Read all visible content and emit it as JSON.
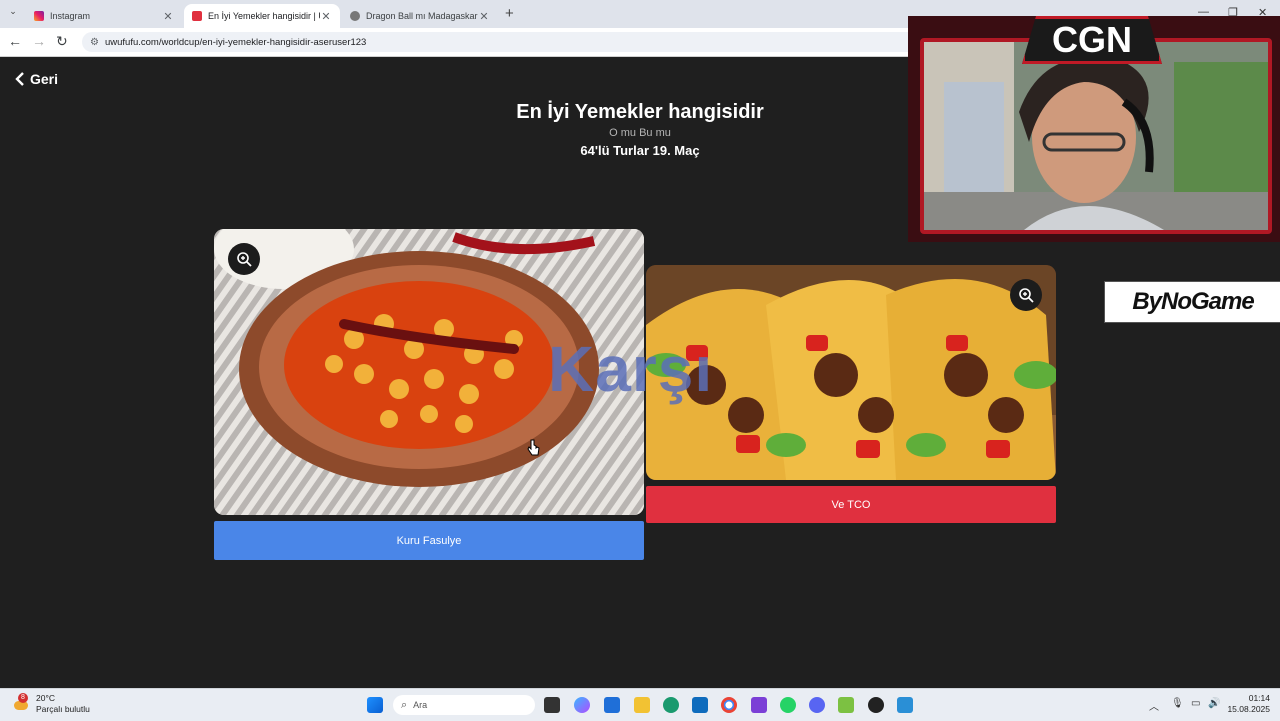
{
  "browser": {
    "tabs": [
      {
        "title": "Instagram",
        "active": false
      },
      {
        "title": "En İyi Yemekler hangisidir | Uwu",
        "active": true
      },
      {
        "title": "Dragon Ball mı Madagaskar mı",
        "active": false
      }
    ],
    "url": "uwufufu.com/worldcup/en-iyi-yemekler-hangisidir-aseruser123"
  },
  "page": {
    "back_label": "Geri",
    "title": "En İyi Yemekler hangisidir",
    "subtitle": "O mu Bu mu",
    "round": "64'lü Turlar 19. Maç",
    "vs_label": "Karşı",
    "choices": [
      {
        "label": "Kuru Fasulye",
        "color": "#4a86e8"
      },
      {
        "label": "Ve TCO",
        "color": "#e0303f"
      }
    ]
  },
  "overlay": {
    "channel_logo": "CGN",
    "sponsor": "ByNoGame"
  },
  "taskbar": {
    "weather_temp": "20°C",
    "weather_desc": "Parçalı bulutlu",
    "weather_badge": "8",
    "search_placeholder": "Ara",
    "time": "01:14",
    "date": "15.08.2025"
  }
}
